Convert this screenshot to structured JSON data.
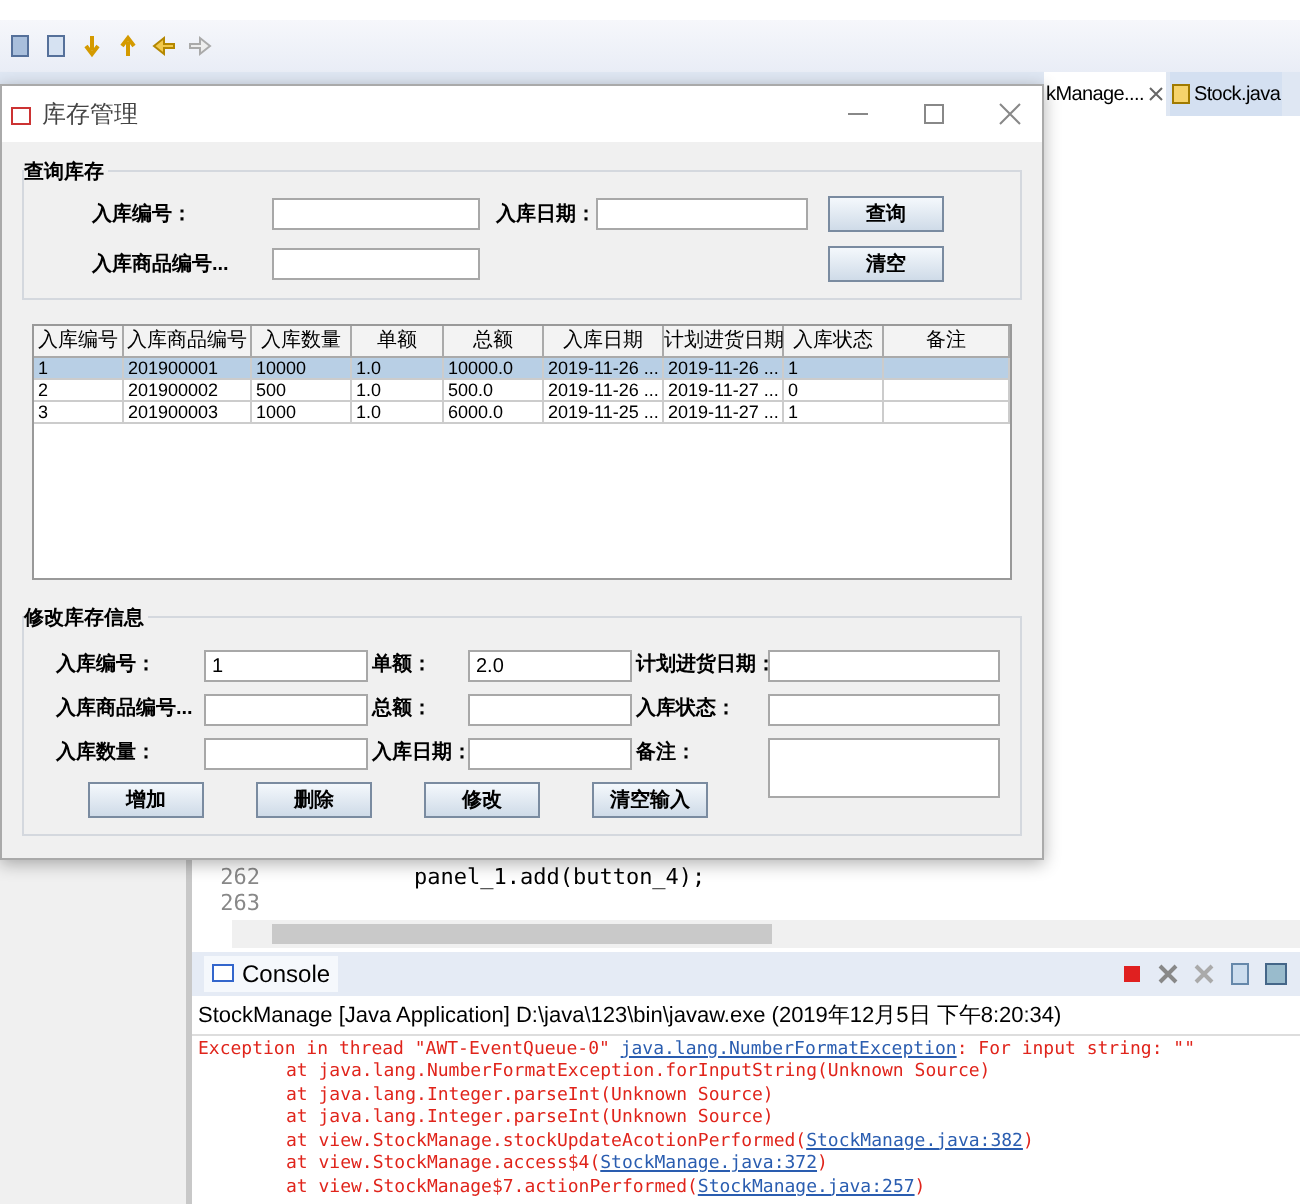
{
  "editor_tabs": [
    {
      "label": "kManage....",
      "selected": true
    },
    {
      "label": "Stock.java",
      "selected": false
    }
  ],
  "code_lines": [
    {
      "number": "262",
      "code": "panel_1.add(button_4);"
    },
    {
      "number": "263"
    }
  ],
  "console": {
    "title": "Console",
    "process": "StockManage [Java Application] D:\\java\\123\\bin\\javaw.exe (2019年12月5日 下午8:20:34)",
    "lines": [
      {
        "kind": "exception",
        "text": "Exception in thread \"AWT-EventQueue-0\" ",
        "link": "java.lang.NumberFormatException",
        "after": ": For input string: \"\""
      },
      {
        "kind": "frame",
        "text": "at java.lang.NumberFormatException.forInputString(Unknown Source)"
      },
      {
        "kind": "frame",
        "text": "at java.lang.Integer.parseInt(Unknown Source)"
      },
      {
        "kind": "frame",
        "text": "at java.lang.Integer.parseInt(Unknown Source)"
      },
      {
        "kind": "frame",
        "text": "at view.StockManage.stockUpdateAcotionPerformed(",
        "link": "StockManage.java:382",
        "after": ")"
      },
      {
        "kind": "frame",
        "text": "at view.StockManage.access$4(",
        "link": "StockManage.java:372",
        "after": ")"
      },
      {
        "kind": "frame",
        "text": "at view.StockManage$7.actionPerformed(",
        "link": "StockManage.java:257",
        "after": ")"
      }
    ]
  },
  "window": {
    "title": "库存管理",
    "query": {
      "title": "查询库存",
      "fields": [
        {
          "label": "入库编号："
        },
        {
          "label": "入库日期："
        },
        {
          "label": "入库商品编号..."
        }
      ],
      "buttons": [
        "查询",
        "清空"
      ]
    },
    "table": {
      "columns": [
        "入库编号",
        "入库商品编号",
        "入库数量",
        "单额",
        "总额",
        "入库日期",
        "计划进货日期",
        "入库状态",
        "备注"
      ],
      "rows": [
        {
          "selected": true,
          "cells": [
            "1",
            "201900001",
            "10000",
            "1.0",
            "10000.0",
            "2019-11-26 ...",
            "2019-11-26 ...",
            "1",
            ""
          ]
        },
        {
          "selected": false,
          "cells": [
            "2",
            "201900002",
            "500",
            "1.0",
            "500.0",
            "2019-11-26 ...",
            "2019-11-27 ...",
            "0",
            ""
          ]
        },
        {
          "selected": false,
          "cells": [
            "3",
            "201900003",
            "1000",
            "1.0",
            "6000.0",
            "2019-11-25 ...",
            "2019-11-27 ...",
            "1",
            ""
          ]
        }
      ]
    },
    "edit": {
      "title": "修改库存信息",
      "fields": [
        {
          "label": "入库编号：",
          "value": "1"
        },
        {
          "label": "单额：",
          "value": "2.0"
        },
        {
          "label": "计划进货日期："
        },
        {
          "label": "入库商品编号..."
        },
        {
          "label": "总额："
        },
        {
          "label": "入库状态："
        },
        {
          "label": "入库数量："
        },
        {
          "label": "入库日期："
        },
        {
          "label": "备注：",
          "kind": "area"
        }
      ],
      "buttons": [
        "增加",
        "删除",
        "修改",
        "清空输入"
      ]
    }
  }
}
